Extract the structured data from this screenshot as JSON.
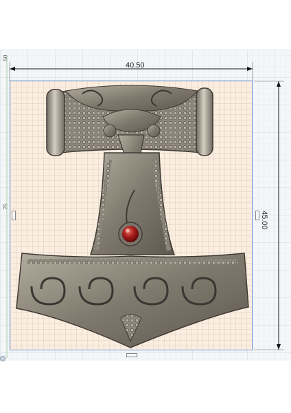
{
  "dimensions": {
    "width_value": "40.50",
    "height_value": "45.00"
  },
  "ruler": {
    "top_left_mark": "50",
    "left_mark": "25"
  },
  "model": {
    "object": "thors-hammer-pendant",
    "gem_color": "#9b1414",
    "metal_color": "#8a8478"
  },
  "colors": {
    "sketch_fill": "#fbeee0",
    "sketch_border": "#6a98d8",
    "dimension_line": "#111111"
  }
}
